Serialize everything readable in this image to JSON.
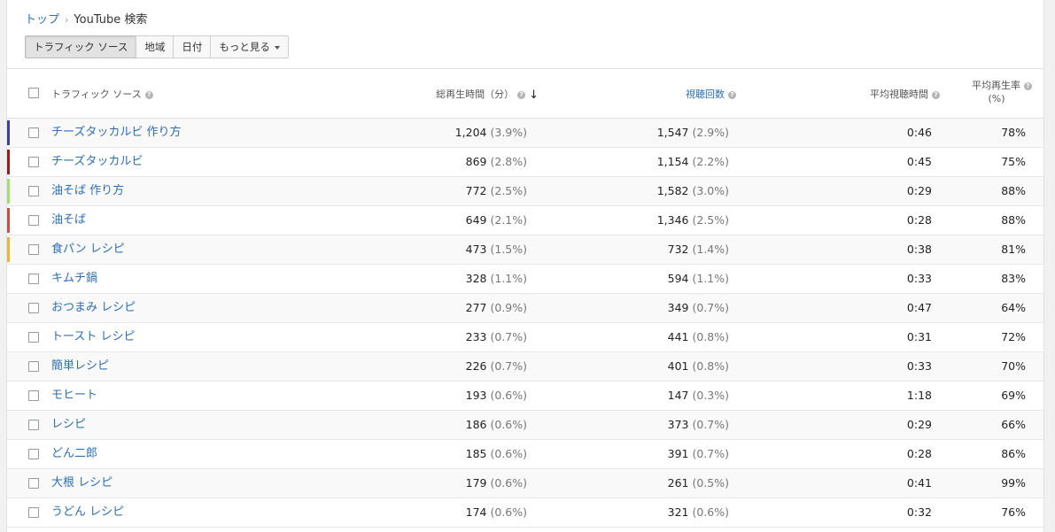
{
  "breadcrumb": {
    "top": "トップ",
    "current": "YouTube 検索"
  },
  "tabs": [
    {
      "label": "トラフィック ソース",
      "active": true
    },
    {
      "label": "地域",
      "active": false
    },
    {
      "label": "日付",
      "active": false
    },
    {
      "label": "もっと見る",
      "active": false,
      "dropdown": true
    }
  ],
  "header": {
    "name": "トラフィック ソース",
    "watch_time": "総再生時間（分）",
    "views": "視聴回数",
    "avg_duration": "平均視聴時間",
    "avg_pct_line1": "平均再生率",
    "avg_pct_line2": "(%)",
    "help_glyph": "?",
    "sort_glyph": "↓",
    "sort_direction": "descending"
  },
  "colors": {
    "link": "#2b6fb6",
    "series": [
      "#3f3e98",
      "#9b1b1b",
      "#9be564",
      "#c9533a",
      "#f4b22c"
    ]
  },
  "rows": [
    {
      "name": "チーズタッカルビ 作り方",
      "watch": "1,204",
      "watch_pct": "(3.9%)",
      "views": "1,547",
      "views_pct": "(2.9%)",
      "avg_duration": "0:46",
      "avg_pct": "78%",
      "color": "#3f3e98"
    },
    {
      "name": "チーズタッカルビ",
      "watch": "869",
      "watch_pct": "(2.8%)",
      "views": "1,154",
      "views_pct": "(2.2%)",
      "avg_duration": "0:45",
      "avg_pct": "75%",
      "color": "#9b1b1b"
    },
    {
      "name": "油そば 作り方",
      "watch": "772",
      "watch_pct": "(2.5%)",
      "views": "1,582",
      "views_pct": "(3.0%)",
      "avg_duration": "0:29",
      "avg_pct": "88%",
      "color": "#9be564"
    },
    {
      "name": "油そば",
      "watch": "649",
      "watch_pct": "(2.1%)",
      "views": "1,346",
      "views_pct": "(2.5%)",
      "avg_duration": "0:28",
      "avg_pct": "88%",
      "color": "#c9533a"
    },
    {
      "name": "食パン レシピ",
      "watch": "473",
      "watch_pct": "(1.5%)",
      "views": "732",
      "views_pct": "(1.4%)",
      "avg_duration": "0:38",
      "avg_pct": "81%",
      "color": "#f4b22c"
    },
    {
      "name": "キムチ鍋",
      "watch": "328",
      "watch_pct": "(1.1%)",
      "views": "594",
      "views_pct": "(1.1%)",
      "avg_duration": "0:33",
      "avg_pct": "83%",
      "color": ""
    },
    {
      "name": "おつまみ レシピ",
      "watch": "277",
      "watch_pct": "(0.9%)",
      "views": "349",
      "views_pct": "(0.7%)",
      "avg_duration": "0:47",
      "avg_pct": "64%",
      "color": ""
    },
    {
      "name": "トースト レシピ",
      "watch": "233",
      "watch_pct": "(0.7%)",
      "views": "441",
      "views_pct": "(0.8%)",
      "avg_duration": "0:31",
      "avg_pct": "72%",
      "color": ""
    },
    {
      "name": "簡単レシピ",
      "watch": "226",
      "watch_pct": "(0.7%)",
      "views": "401",
      "views_pct": "(0.8%)",
      "avg_duration": "0:33",
      "avg_pct": "70%",
      "color": ""
    },
    {
      "name": "モヒート",
      "watch": "193",
      "watch_pct": "(0.6%)",
      "views": "147",
      "views_pct": "(0.3%)",
      "avg_duration": "1:18",
      "avg_pct": "69%",
      "color": ""
    },
    {
      "name": "レシピ",
      "watch": "186",
      "watch_pct": "(0.6%)",
      "views": "373",
      "views_pct": "(0.7%)",
      "avg_duration": "0:29",
      "avg_pct": "66%",
      "color": ""
    },
    {
      "name": "どん二郎",
      "watch": "185",
      "watch_pct": "(0.6%)",
      "views": "391",
      "views_pct": "(0.7%)",
      "avg_duration": "0:28",
      "avg_pct": "86%",
      "color": ""
    },
    {
      "name": "大根 レシピ",
      "watch": "179",
      "watch_pct": "(0.6%)",
      "views": "261",
      "views_pct": "(0.5%)",
      "avg_duration": "0:41",
      "avg_pct": "99%",
      "color": ""
    },
    {
      "name": "うどん レシピ",
      "watch": "174",
      "watch_pct": "(0.6%)",
      "views": "321",
      "views_pct": "(0.6%)",
      "avg_duration": "0:32",
      "avg_pct": "76%",
      "color": ""
    }
  ]
}
